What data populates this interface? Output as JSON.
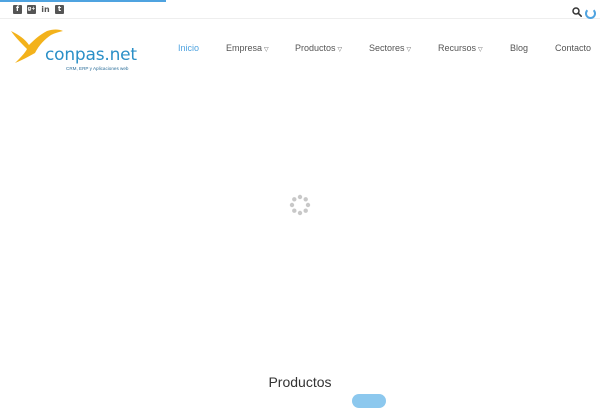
{
  "brand": {
    "name": "conpas.net",
    "tagline": "CRM, ERP y Aplicaciones web",
    "colors": {
      "accent": "#4fa3e0",
      "logo_blue": "#2a8fc7",
      "bird_yellow": "#f3b21b"
    }
  },
  "topbar": {
    "social": [
      {
        "icon": "facebook-icon",
        "glyph": "f"
      },
      {
        "icon": "google-plus-icon",
        "glyph": "g+"
      },
      {
        "icon": "linkedin-icon",
        "glyph": "in"
      },
      {
        "icon": "twitter-icon",
        "glyph": "t"
      }
    ],
    "search_icon": "search-icon",
    "loading_icon": "loading-spinner-icon"
  },
  "nav": {
    "items": [
      {
        "label": "Inicio",
        "active": true,
        "dropdown": false
      },
      {
        "label": "Empresa",
        "active": false,
        "dropdown": true
      },
      {
        "label": "Productos",
        "active": false,
        "dropdown": true
      },
      {
        "label": "Sectores",
        "active": false,
        "dropdown": true
      },
      {
        "label": "Recursos",
        "active": false,
        "dropdown": true
      },
      {
        "label": "Blog",
        "active": false,
        "dropdown": false
      },
      {
        "label": "Contacto",
        "active": false,
        "dropdown": false
      }
    ]
  },
  "main": {
    "loader_icon": "loading-icon",
    "section_title": "Productos"
  }
}
